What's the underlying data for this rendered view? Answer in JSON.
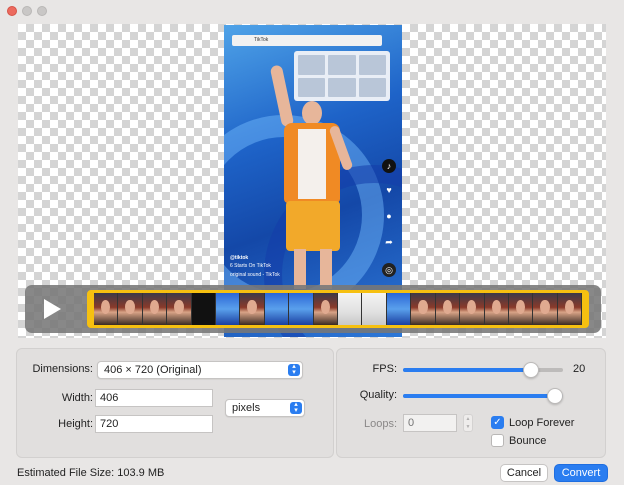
{
  "window": {
    "traffic_lights": [
      "close",
      "minimize",
      "maximize"
    ]
  },
  "preview": {
    "video_title": "TikTok",
    "tiktok_handle": "@tiktok",
    "tiktok_caption": "6 Starts On TikTok",
    "tiktok_sound": "original sound - TikTok"
  },
  "timeline": {
    "play_icon": "play-icon",
    "frames": [
      "person",
      "person",
      "person",
      "person",
      "dark",
      "blue",
      "person",
      "blue",
      "blue",
      "person",
      "white",
      "white",
      "blue",
      "person",
      "person",
      "person",
      "person",
      "person",
      "person",
      "person"
    ]
  },
  "settings": {
    "dimensions_label": "Dimensions:",
    "dimensions_value": "406 × 720 (Original)",
    "width_label": "Width:",
    "width_value": "406",
    "height_label": "Height:",
    "height_value": "720",
    "unit_value": "pixels",
    "fps_label": "FPS:",
    "fps_value": "20",
    "fps_fraction": 0.8,
    "quality_label": "Quality:",
    "quality_fraction": 1.0,
    "loops_label": "Loops:",
    "loops_placeholder": "0",
    "loop_forever_label": "Loop Forever",
    "loop_forever_checked": true,
    "bounce_label": "Bounce",
    "bounce_checked": false
  },
  "footer": {
    "estimated_size": "Estimated File Size: 103.9 MB",
    "cancel_label": "Cancel",
    "convert_label": "Convert"
  },
  "colors": {
    "accent": "#2a7df0",
    "trim_handle": "#f6c010",
    "close_button": "#ec6a5e"
  }
}
